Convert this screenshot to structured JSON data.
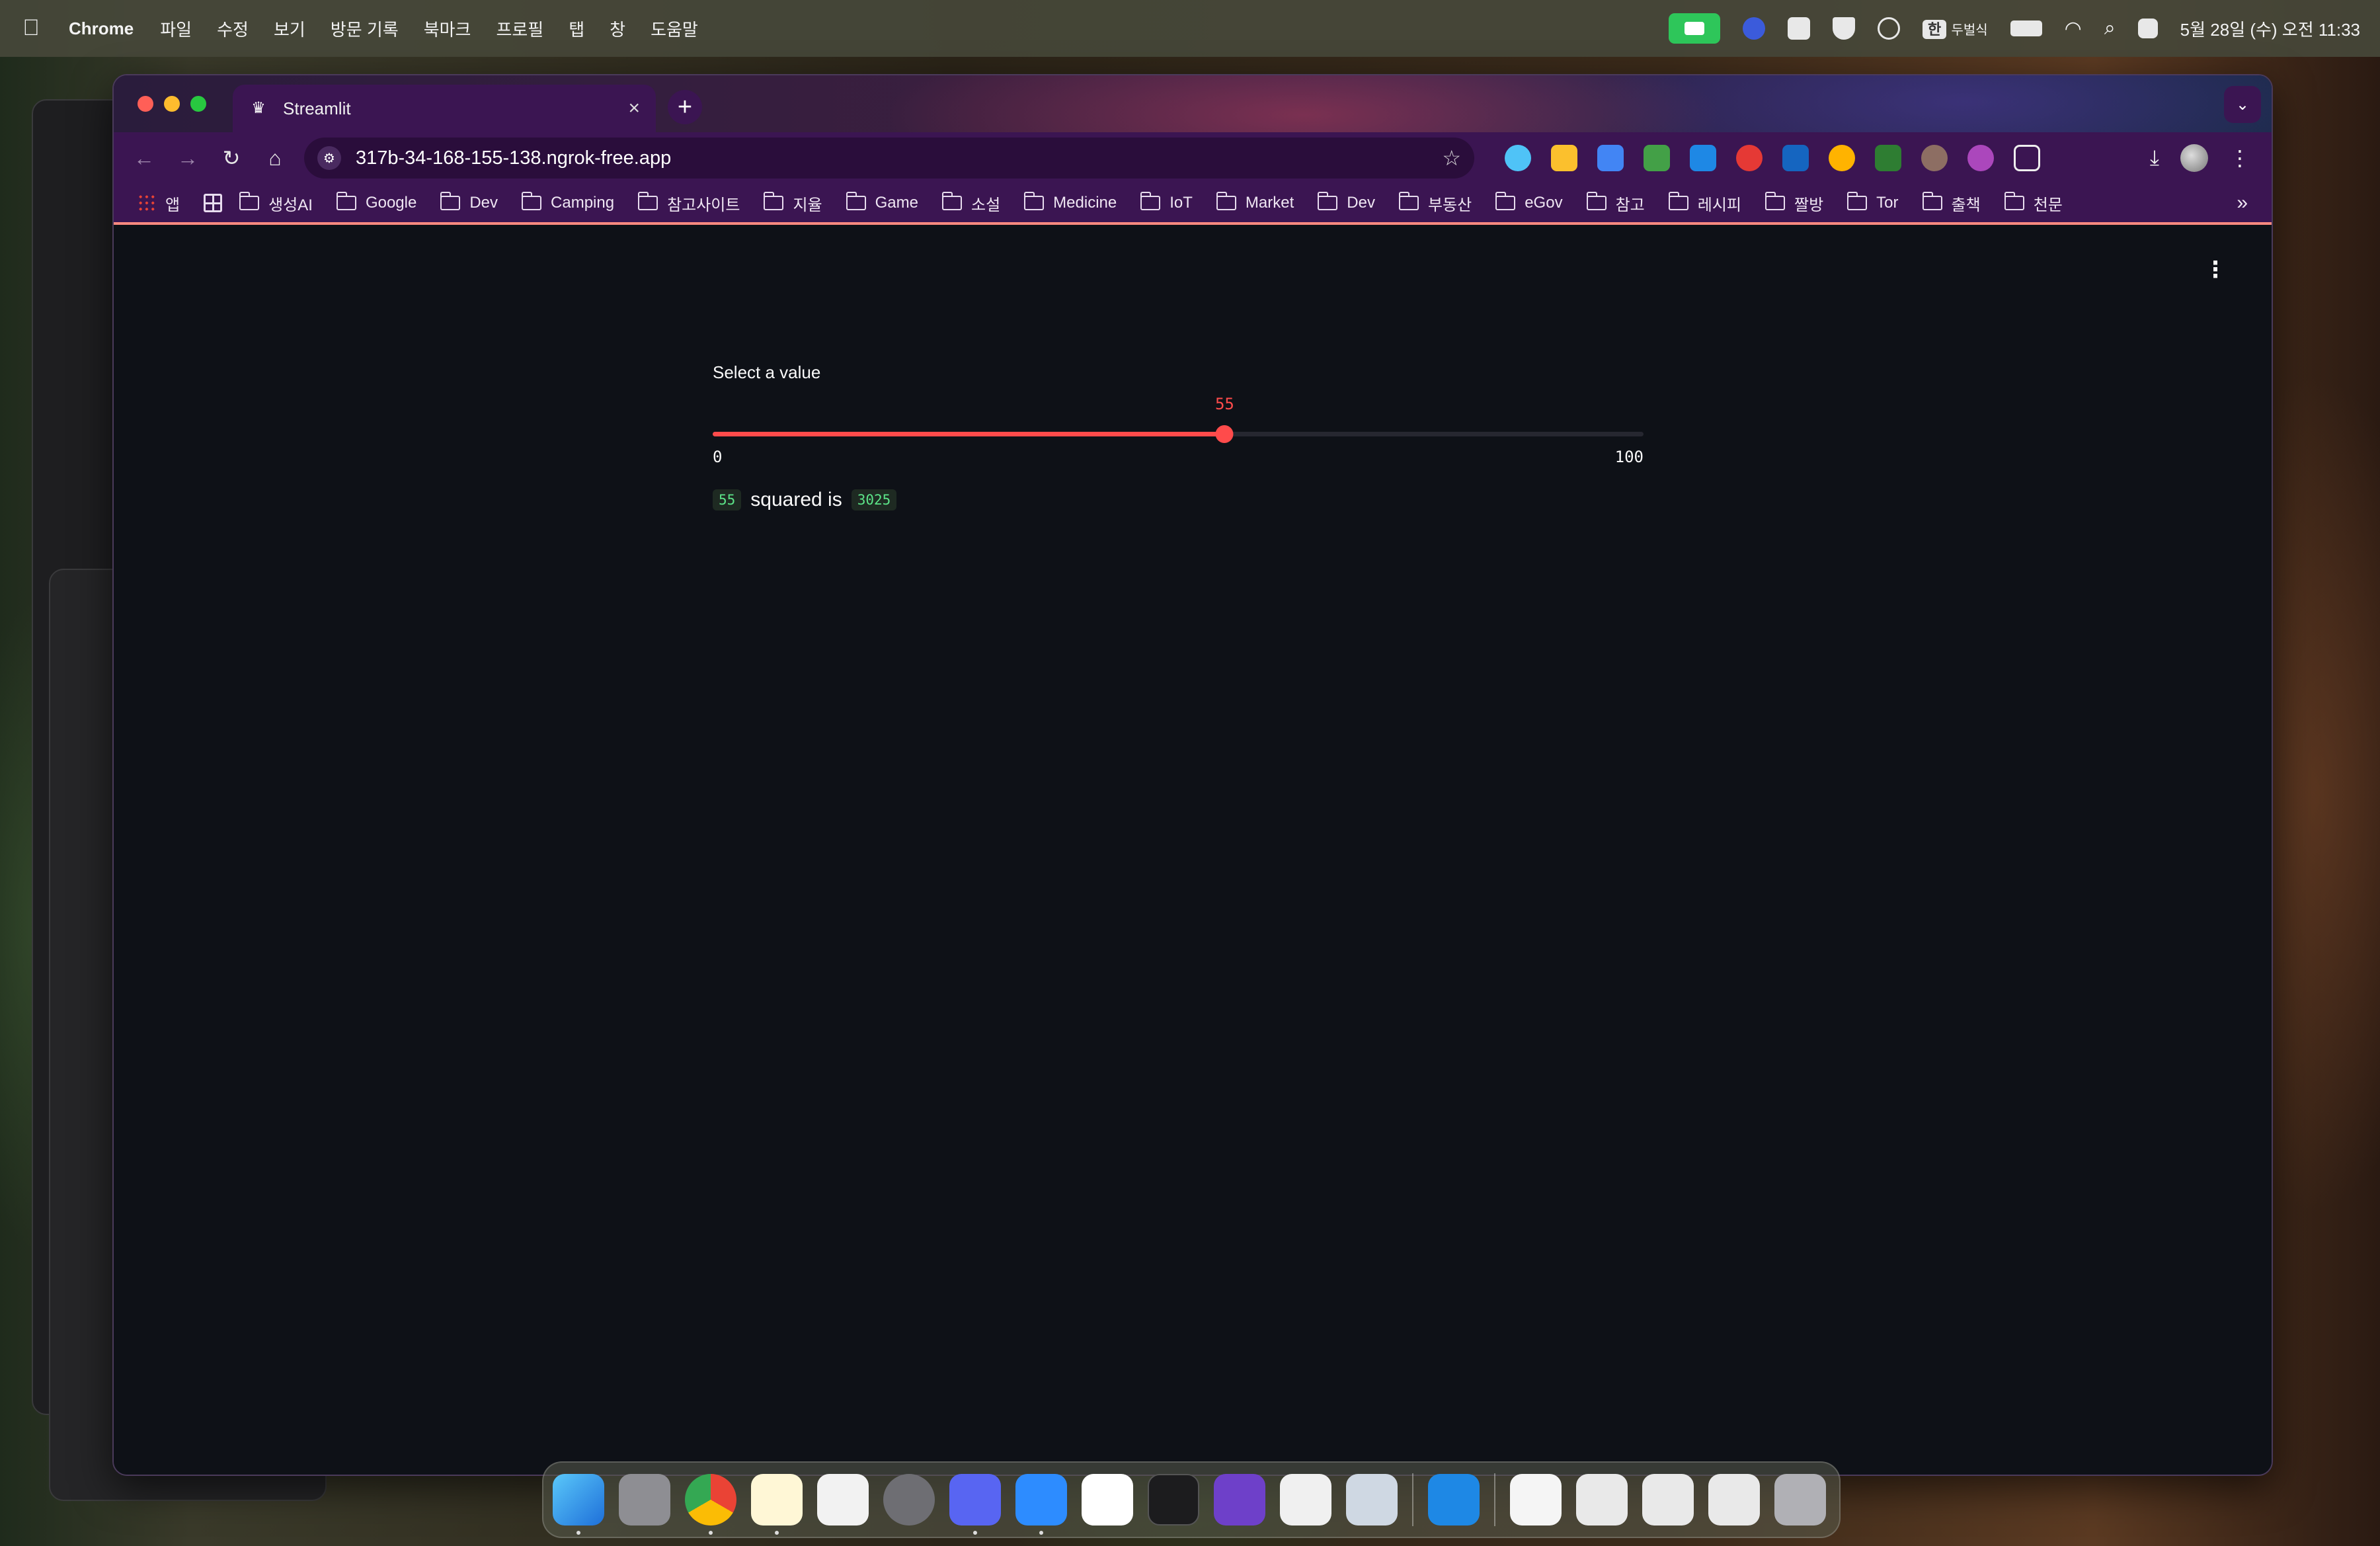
{
  "menubar": {
    "app_name": "Chrome",
    "menus": [
      "파일",
      "수정",
      "보기",
      "방문 기록",
      "북마크",
      "프로필",
      "탭",
      "창",
      "도움말"
    ],
    "ime_label": "한",
    "ime_name": "두벌식",
    "clock": "5월 28일 (수) 오전 11:33"
  },
  "browser": {
    "tab_title": "Streamlit",
    "tab_close": "×",
    "new_tab": "+",
    "url": "317b-34-168-155-138.ngrok-free.app",
    "back": "←",
    "forward": "→",
    "reload": "↻",
    "home": "⌂",
    "star": "☆",
    "download": "⤓",
    "menu": "⋮",
    "bookmarks": [
      "생성AI",
      "Google",
      "Dev",
      "Camping",
      "참고사이트",
      "지율",
      "Game",
      "소설",
      "Medicine",
      "IoT",
      "Market",
      "Dev",
      "부동산",
      "eGov",
      "참고",
      "레시피",
      "짤방",
      "Tor",
      "출책",
      "천문"
    ],
    "apps_label": "앱",
    "overflow": "»"
  },
  "page": {
    "menu_icon": "⋮",
    "slider": {
      "label": "Select a value",
      "value": 55,
      "value_text": "55",
      "min": 0,
      "max": 100,
      "min_text": "0",
      "max_text": "100"
    },
    "result": {
      "value": "55",
      "text": "squared is",
      "square": "3025"
    }
  },
  "colors": {
    "accent": "#ff4b4b",
    "page_bg": "#0e1117",
    "browser_theme": "#3b1552"
  }
}
